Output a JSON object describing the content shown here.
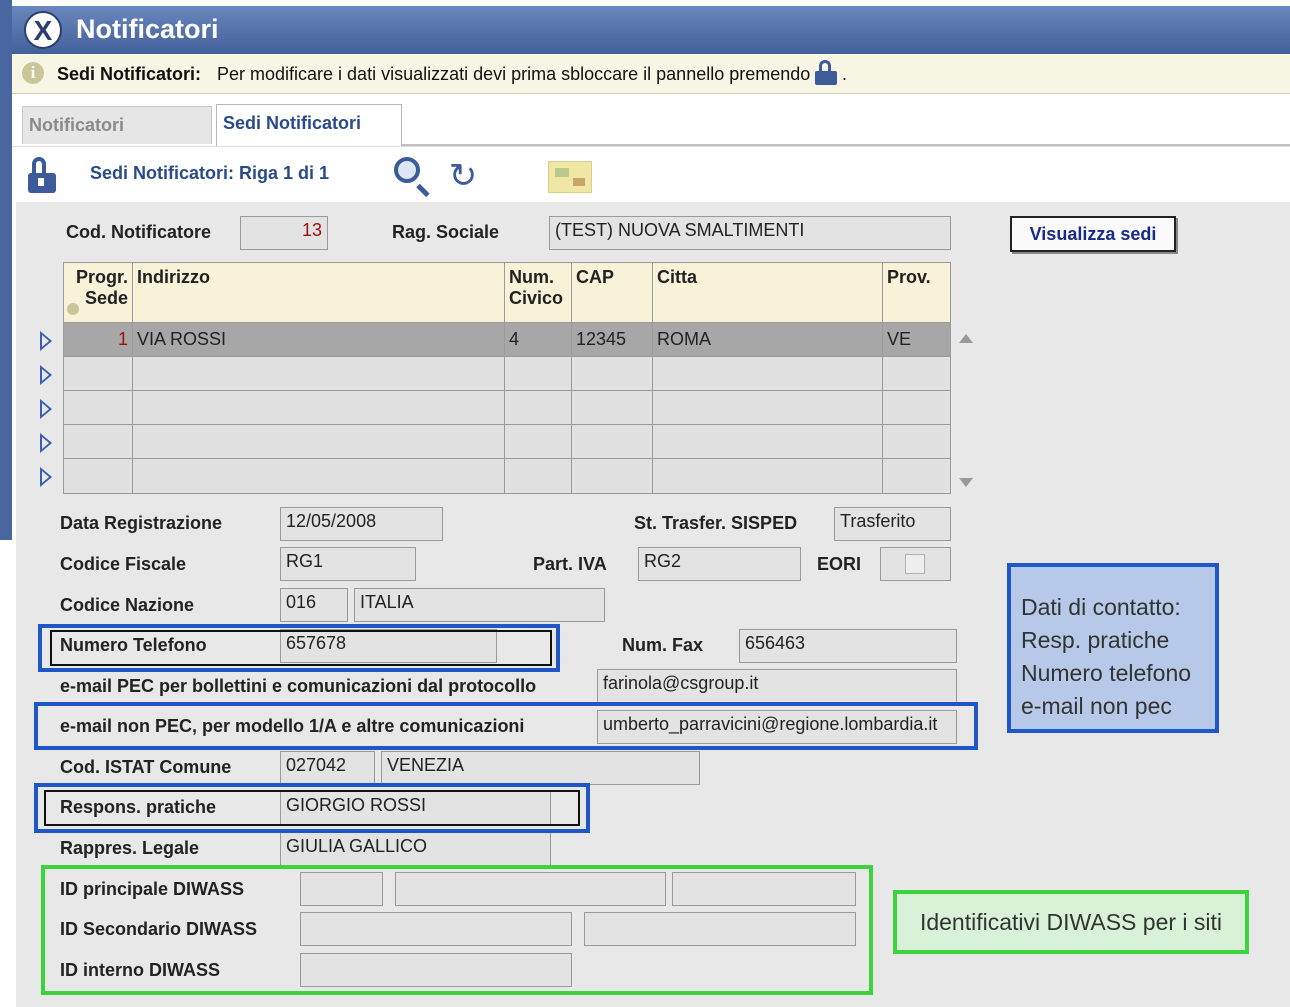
{
  "window": {
    "title": "Notificatori"
  },
  "info": {
    "prefix": "Sedi Notificatori:",
    "text": "Per modificare i dati visualizzati devi prima sbloccare il pannello premendo",
    "suffix": "."
  },
  "tabs": [
    {
      "label": "Notificatori"
    },
    {
      "label": "Sedi Notificatori"
    }
  ],
  "toolbar": {
    "title": "Sedi Notificatori: Riga 1 di 1"
  },
  "header_form": {
    "cod_label": "Cod. Notificatore",
    "cod_value": "13",
    "rag_label": "Rag. Sociale",
    "rag_value": "(TEST) NUOVA SMALTIMENTI",
    "visualizza_button": "Visualizza sedi"
  },
  "grid": {
    "columns": [
      "Progr. Sede",
      "Indirizzo",
      "Num. Civico",
      "CAP",
      "Citta",
      "Prov."
    ],
    "col_progr_1": "Progr.",
    "col_progr_2": "Sede",
    "col_num_1": "Num.",
    "col_num_2": "Civico",
    "row": {
      "progr": "1",
      "indirizzo": "VIA ROSSI",
      "civico": "4",
      "cap": "12345",
      "citta": "ROMA",
      "prov": "VE"
    }
  },
  "form": {
    "data_reg_label": "Data Registrazione",
    "data_reg": "12/05/2008",
    "st_trasfer_label": "St. Trasfer. SISPED",
    "st_trasfer": "Trasferito",
    "cf_label": "Codice Fiscale",
    "cf": "RG1",
    "piva_label": "Part. IVA",
    "piva": "RG2",
    "eori_label": "EORI",
    "nazione_label": "Codice Nazione",
    "nazione_code": "016",
    "nazione_name": "ITALIA",
    "tel_label": "Numero Telefono",
    "tel": "657678",
    "fax_label": "Num. Fax",
    "fax": "656463",
    "pec_label": "e-mail PEC per bollettini e comunicazioni dal protocollo",
    "pec": "farinola@csgroup.it",
    "nonpec_label": "e-mail non PEC, per modello 1/A e altre comunicazioni",
    "nonpec": "umberto_parravicini@regione.lombardia.it",
    "istat_label": "Cod. ISTAT Comune",
    "istat_code": "027042",
    "istat_name": "VENEZIA",
    "resp_label": "Respons. pratiche",
    "resp": "GIORGIO ROSSI",
    "rappr_label": "Rappres. Legale",
    "rappr": "GIULIA GALLICO",
    "id_princ_label": "ID principale DIWASS",
    "id_sec_label": "ID Secondario DIWASS",
    "id_int_label": "ID interno DIWASS"
  },
  "annotations": {
    "blue_lines": [
      "Dati di contatto:",
      "Resp. pratiche",
      "Numero telefono",
      "e-mail non pec"
    ],
    "green_text": "Identificativi DIWASS per i siti"
  },
  "colors": {
    "titlebar": "#4f6fa3",
    "blue_box": "#1f57c8",
    "green_box": "#3fd23f",
    "panel": "#e8e8e8"
  }
}
